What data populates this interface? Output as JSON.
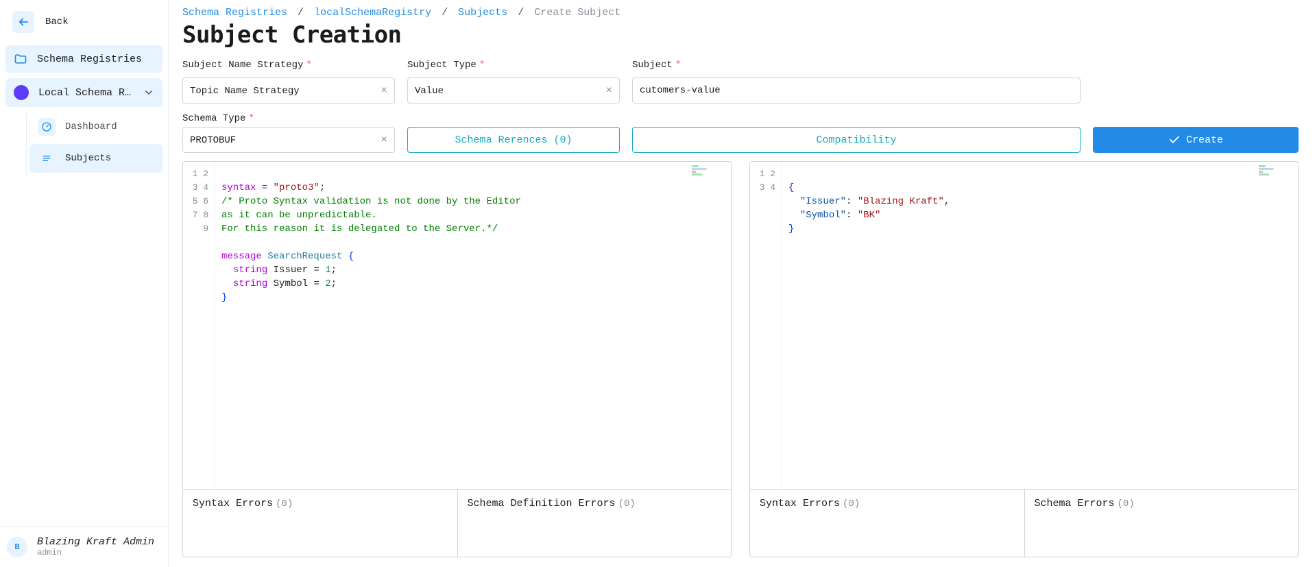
{
  "sidebar": {
    "back_label": "Back",
    "nav": {
      "schema_registries": "Schema Registries",
      "local_registry": "Local Schema Regi…",
      "dashboard": "Dashboard",
      "subjects": "Subjects"
    },
    "user": {
      "avatar_initial": "B",
      "name": "Blazing Kraft Admin",
      "role": "admin"
    }
  },
  "breadcrumb": {
    "items": [
      "Schema Registries",
      "localSchemaRegistry",
      "Subjects"
    ],
    "current": "Create Subject"
  },
  "page_title": "Subject Creation",
  "form": {
    "strategy": {
      "label": "Subject Name Strategy",
      "value": "Topic Name Strategy"
    },
    "subject_type": {
      "label": "Subject Type",
      "value": "Value"
    },
    "subject": {
      "label": "Subject",
      "value": "cutomers-value"
    },
    "schema_type": {
      "label": "Schema Type",
      "value": "PROTOBUF"
    },
    "refs_btn": "Schema Rerences (0)",
    "compat_btn": "Compatibility",
    "create_btn": "Create"
  },
  "left_editor": {
    "line_count": 9,
    "lines": {
      "l1_pre": "syntax = ",
      "l1_str": "\"proto3\"",
      "l1_post": ";",
      "l2": "/* Proto Syntax validation is not done by the Editor",
      "l3": "as it can be unpredictable.",
      "l4": "For this reason it is delegated to the Server.*/",
      "l5": "",
      "l6_kw": "message",
      "l6_name": " SearchRequest ",
      "l6_brace": "{",
      "l7_ind": "  ",
      "l7_kw": "string",
      "l7_rest": " Issuer = ",
      "l7_num": "1",
      "l7_end": ";",
      "l8_ind": "  ",
      "l8_kw": "string",
      "l8_rest": " Symbol = ",
      "l8_num": "2",
      "l8_end": ";",
      "l9": "}"
    }
  },
  "right_editor": {
    "line_count": 4,
    "lines": {
      "l1": "{",
      "l2_ind": "  ",
      "l2_key": "\"Issuer\"",
      "l2_sep": ": ",
      "l2_val": "\"Blazing Kraft\"",
      "l2_end": ",",
      "l3_ind": "  ",
      "l3_key": "\"Symbol\"",
      "l3_sep": ": ",
      "l3_val": "\"BK\"",
      "l4": "}"
    }
  },
  "errors": {
    "left": {
      "syntax_title": "Syntax Errors",
      "syntax_count": "(0)",
      "schema_title": "Schema Definition Errors",
      "schema_count": "(0)"
    },
    "right": {
      "syntax_title": "Syntax Errors",
      "syntax_count": "(0)",
      "schema_title": "Schema Errors",
      "schema_count": "(0)"
    }
  }
}
